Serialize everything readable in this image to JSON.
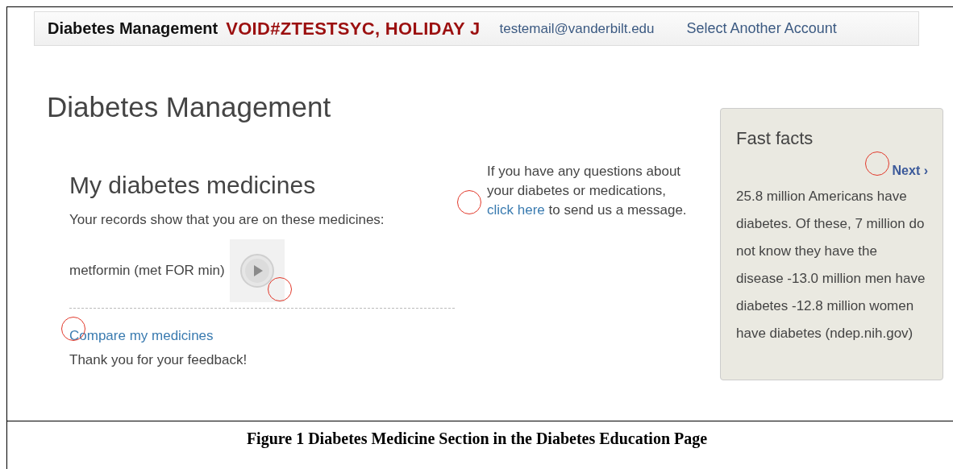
{
  "header": {
    "title": "Diabetes Management",
    "patient": "VOID#ZTESTSYC, HOLIDAY J",
    "email": "testemail@vanderbilt.edu",
    "switch_account": "Select Another Account"
  },
  "page_title": "Diabetes Management",
  "medicines_section": {
    "title": "My diabetes medicines",
    "intro": "Your records show that you are on these medicines:",
    "medicines": [
      {
        "name": "metformin (met FOR min)"
      }
    ],
    "compare_link": "Compare my medicines",
    "feedback": "Thank you for your feedback!"
  },
  "contact": {
    "text": "If you have any questions about your diabetes or medications,",
    "link": "click here",
    "after": "to send us a message."
  },
  "fast_facts": {
    "title": "Fast facts",
    "next": "Next ›",
    "text": "25.8 million Americans have diabetes. Of these, 7 million do not know they have the disease -13.0 million men have diabetes -12.8 million women have diabetes (ndep.nih.gov)"
  },
  "caption": "Figure 1 Diabetes Medicine Section in the Diabetes Education Page"
}
